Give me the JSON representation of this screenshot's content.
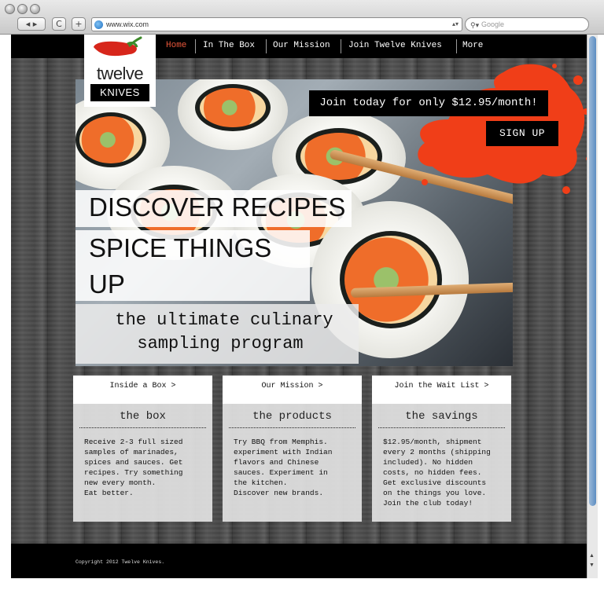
{
  "browser": {
    "url": "www.wix.com",
    "search_placeholder": "Google",
    "back_forward": "◂ ▸",
    "reload": "C",
    "add_tab": "+"
  },
  "nav": {
    "items": [
      {
        "label": "Home"
      },
      {
        "label": "In The Box"
      },
      {
        "label": "Our Mission"
      },
      {
        "label": "Join Twelve Knives"
      },
      {
        "label": "More"
      }
    ]
  },
  "logo": {
    "word": "twelve",
    "sub": "KNIVES"
  },
  "promo": {
    "text": "Join today for only $12.95/month!",
    "signup_label": "SIGN UP"
  },
  "hero": {
    "line1": "DISCOVER RECIPES",
    "line2": "SPICE THINGS",
    "line3": "UP",
    "tag1": "the ultimate culinary",
    "tag2": "sampling program"
  },
  "cards": [
    {
      "button": "Inside a Box >",
      "title": "the box",
      "body": "Receive 2-3 full sized\nsamples of marinades,\nspices and sauces. Get\nrecipes. Try something\nnew every month.\nEat better."
    },
    {
      "button": "Our Mission >",
      "title": "the products",
      "body": "Try BBQ from Memphis.\nexperiment with Indian\nflavors and Chinese\nsauces. Experiment in\nthe kitchen.\nDiscover new brands."
    },
    {
      "button": "Join the Wait List >",
      "title": "the savings",
      "body": "$12.95/month, shipment\nevery 2 months (shipping\nincluded). No hidden\ncosts, no hidden fees.\nGet exclusive discounts\non the things you love.\nJoin the club today!"
    }
  ],
  "footer": {
    "copyright": "Copyright 2012 Twelve Knives."
  },
  "colors": {
    "accent": "#e8563a",
    "splat": "#f03e18",
    "pepper": "#d7261b"
  }
}
